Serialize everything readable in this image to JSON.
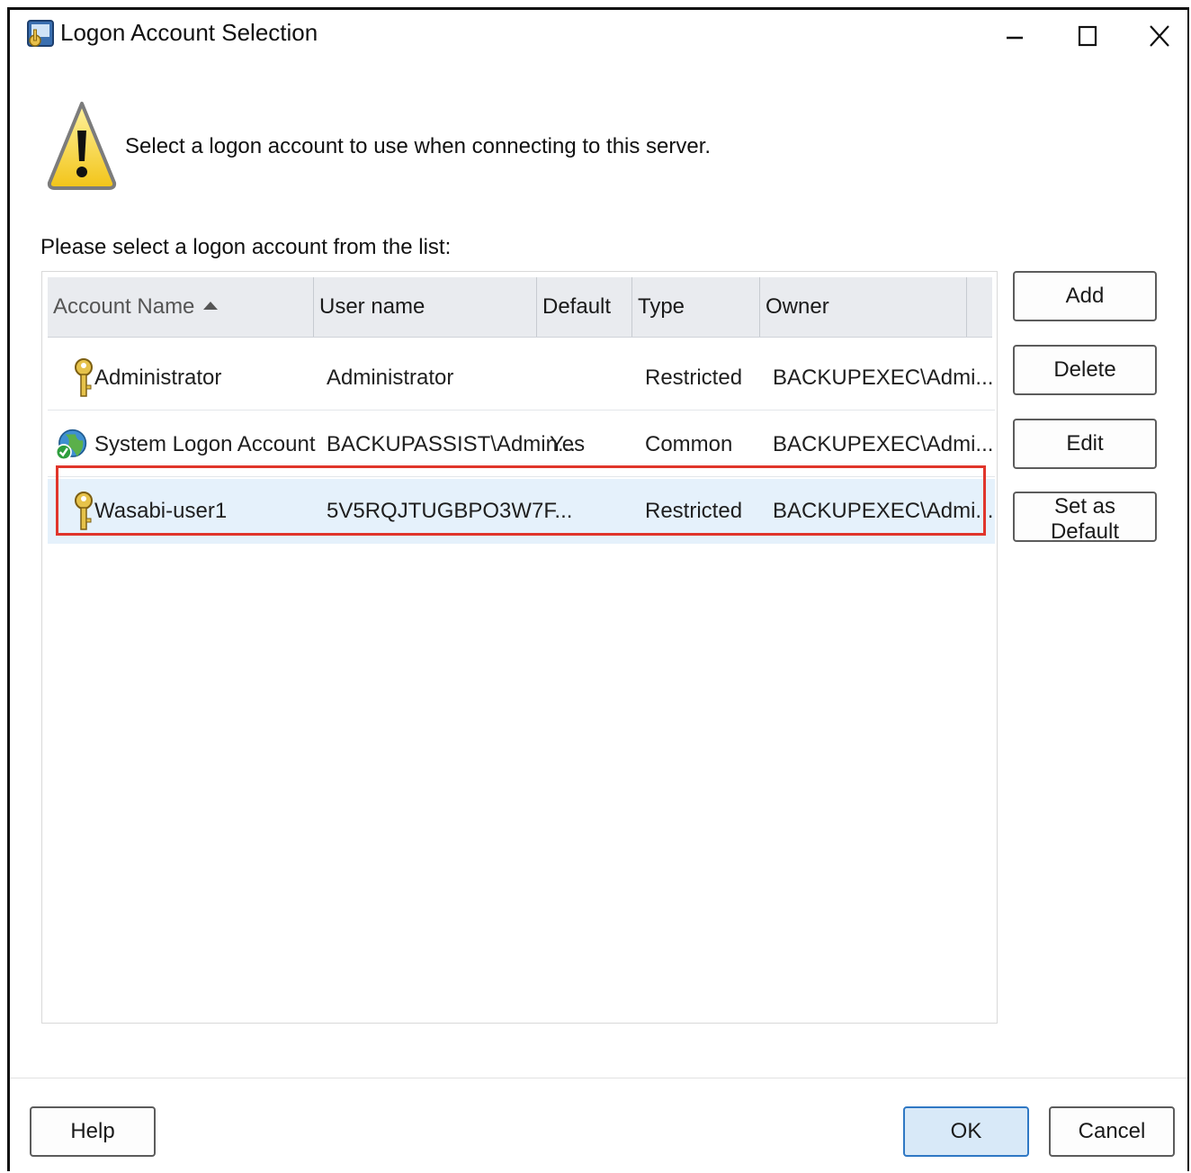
{
  "window": {
    "title": "Logon Account Selection",
    "controls": [
      "minimize-icon",
      "maximize-icon",
      "close-icon"
    ]
  },
  "intro": {
    "icon": "warning-icon",
    "text": "Select a logon account to use when connecting to this server."
  },
  "list_label": "Please select a logon account from the list:",
  "columns": [
    {
      "label": "Account Name",
      "sorted": "ascending"
    },
    {
      "label": "User name"
    },
    {
      "label": "Default"
    },
    {
      "label": "Type"
    },
    {
      "label": "Owner"
    }
  ],
  "rows": [
    {
      "icon": "key-icon",
      "account_name": "Administrator",
      "user_name": "Administrator",
      "default": "",
      "type": "Restricted",
      "owner": "BACKUPEXEC\\Admi...",
      "selected": false
    },
    {
      "icon": "globe-check-icon",
      "account_name": "System Logon Account",
      "user_name": "BACKUPASSIST\\Admin...",
      "default": "Yes",
      "type": "Common",
      "owner": "BACKUPEXEC\\Admi...",
      "selected": false
    },
    {
      "icon": "key-icon",
      "account_name": "Wasabi-user1",
      "user_name": "5V5RQJTUGBPO3W7F...",
      "default": "",
      "type": "Restricted",
      "owner": "BACKUPEXEC\\Admi...",
      "selected": true
    }
  ],
  "side_buttons": {
    "add": "Add",
    "delete": "Delete",
    "edit": "Edit",
    "set_default": "Set as Default"
  },
  "bottom_buttons": {
    "help": "Help",
    "ok": "OK",
    "cancel": "Cancel"
  },
  "colors": {
    "highlight_border": "#e0352b",
    "selected_row": "#e5f1fb",
    "ok_button": "#d8e9f8"
  }
}
